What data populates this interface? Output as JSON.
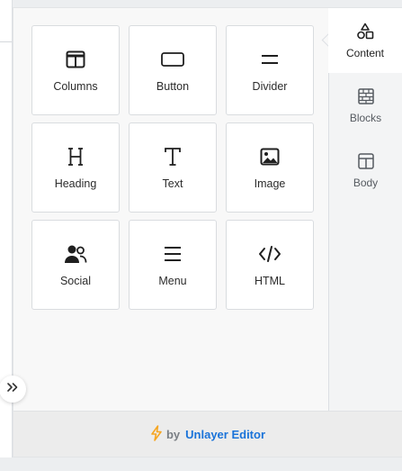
{
  "tools": [
    {
      "label": "Columns",
      "icon": "columns-icon"
    },
    {
      "label": "Button",
      "icon": "button-icon"
    },
    {
      "label": "Divider",
      "icon": "divider-icon"
    },
    {
      "label": "Heading",
      "icon": "heading-icon"
    },
    {
      "label": "Text",
      "icon": "text-icon"
    },
    {
      "label": "Image",
      "icon": "image-icon"
    },
    {
      "label": "Social",
      "icon": "social-icon"
    },
    {
      "label": "Menu",
      "icon": "menu-icon"
    },
    {
      "label": "HTML",
      "icon": "html-code-icon"
    }
  ],
  "tabs": [
    {
      "label": "Content",
      "icon": "shapes-icon",
      "active": true
    },
    {
      "label": "Blocks",
      "icon": "blocks-icon",
      "active": false
    },
    {
      "label": "Body",
      "icon": "layout-icon",
      "active": false
    }
  ],
  "footer": {
    "by_label": "by",
    "brand": "Unlayer Editor",
    "bolt_icon": "bolt-icon",
    "bolt_color": "#f6a623",
    "brand_color": "#1a73d9"
  },
  "collapse_icon": "double-chevron-right-icon"
}
